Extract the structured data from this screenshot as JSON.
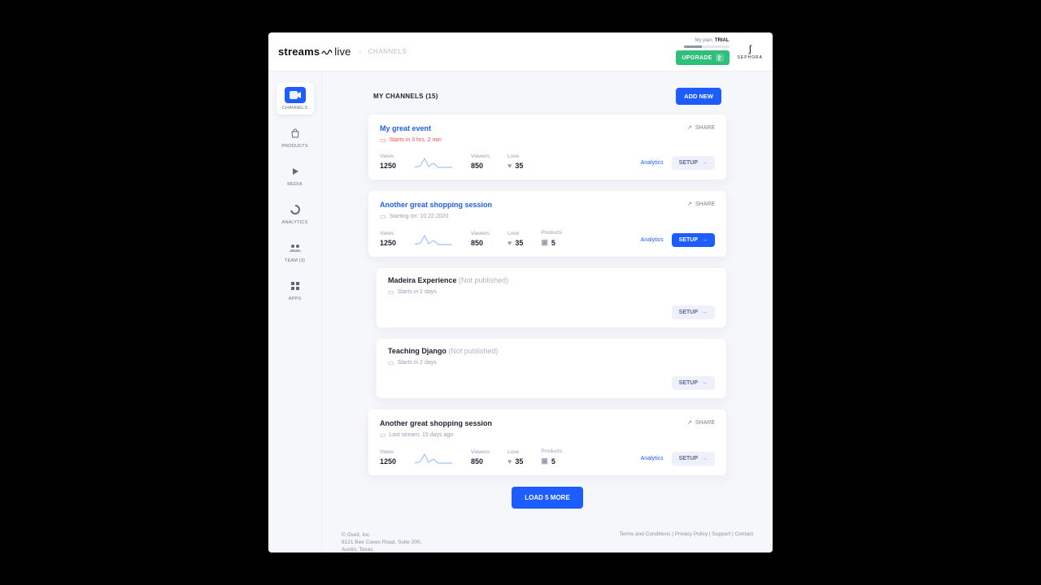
{
  "header": {
    "logo_prefix": "streams",
    "logo_suffix": "live",
    "breadcrumb": "CHANNELS",
    "plan_label": "My plan:",
    "plan_value": "TRIAL",
    "upgrade": "UPGRADE",
    "brand": "SEPHORA"
  },
  "sidebar": {
    "items": [
      {
        "label": "CHANNELS",
        "icon": "video",
        "active": true
      },
      {
        "label": "PRODUCTS",
        "icon": "bag"
      },
      {
        "label": "MEDIA",
        "icon": "play"
      },
      {
        "label": "ANALYTICS",
        "icon": "chart"
      },
      {
        "label": "TEAM (3)",
        "icon": "team"
      },
      {
        "label": "APPS",
        "icon": "apps"
      }
    ]
  },
  "section": {
    "title": "MY CHANNELS (15)",
    "add": "ADD NEW",
    "load_more": "LOAD 5 MORE"
  },
  "labels": {
    "share": "SHARE",
    "analytics": "Analytics",
    "setup": "SETUP",
    "views": "Views",
    "viewers": "Viewers",
    "love": "Love",
    "products": "Products",
    "not_published": "(Not published)"
  },
  "cards": [
    {
      "title": "My great event",
      "link": true,
      "meta": "Starts in 3 hrs. 2 min",
      "meta_red": true,
      "views": "1250",
      "viewers": "850",
      "love": "35",
      "products": null,
      "setup_filled": false,
      "show_stats": true,
      "sub": false
    },
    {
      "title": "Another great shopping session",
      "link": true,
      "meta": "Starting on: 10.22.2020",
      "meta_red": false,
      "views": "1250",
      "viewers": "850",
      "love": "35",
      "products": "5",
      "setup_filled": true,
      "show_stats": true,
      "sub": false
    },
    {
      "title": "Madeira Experience",
      "link": false,
      "not_published": true,
      "meta": "Starts in 2 days",
      "meta_red": false,
      "show_stats": false,
      "sub": true
    },
    {
      "title": "Teaching Django",
      "link": false,
      "not_published": true,
      "meta": "Starts in 2 days",
      "meta_red": false,
      "show_stats": false,
      "sub": true
    },
    {
      "title": "Another great shopping session",
      "link": false,
      "meta": "Last stream: 15 days ago",
      "meta_red": false,
      "views": "1250",
      "viewers": "850",
      "love": "35",
      "products": "5",
      "setup_filled": false,
      "show_stats": true,
      "sub": false
    }
  ],
  "footer": {
    "copyright": "© Oveit, Inc.",
    "address1": "8121 Bee Caves Road, Suite 200,",
    "address2": "Austin, Texas",
    "links": [
      "Terms and Conditions",
      "Privacy Policy",
      "Support",
      "Contact"
    ]
  }
}
